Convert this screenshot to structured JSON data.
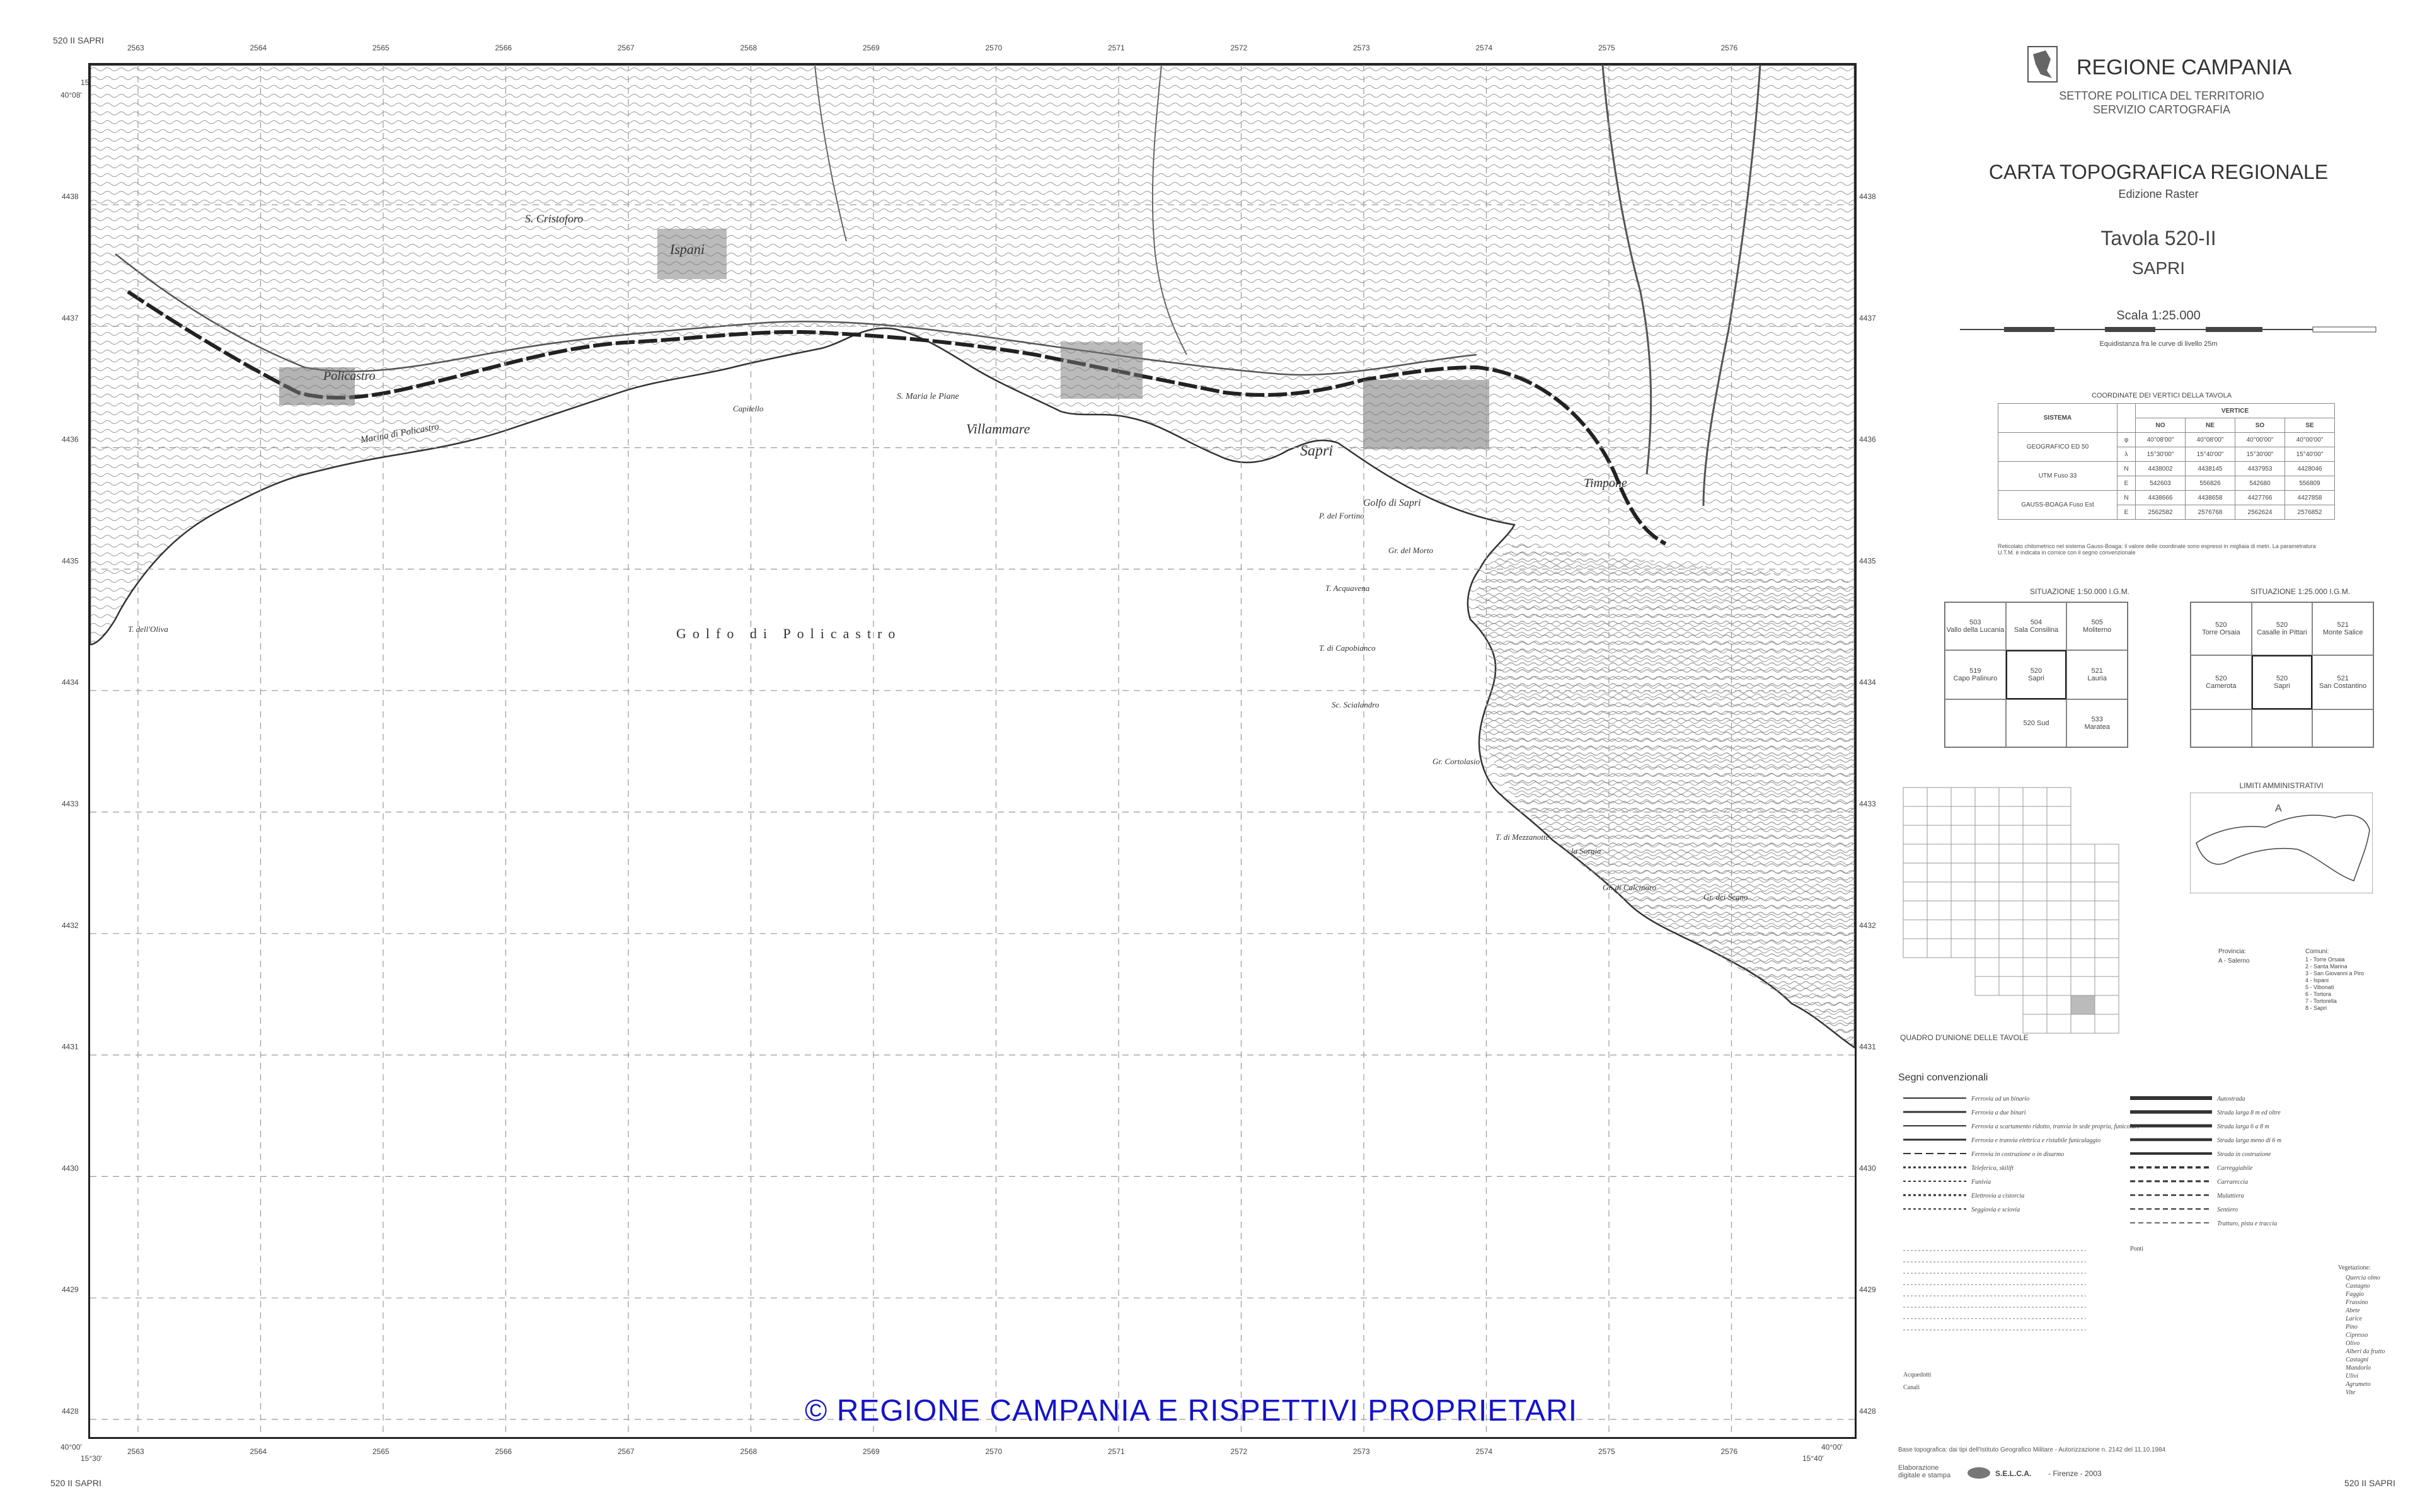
{
  "sheet_corner_top": "520 II SAPRI",
  "sheet_corner_bottom_left": "520 II SAPRI",
  "sheet_corner_bottom_right": "520 II SAPRI",
  "map": {
    "corner_lon_left": "15°30'",
    "corner_lon_right": "15°40'",
    "corner_lat": "40°08'",
    "corner_lat_bottom": "40°00'",
    "eastings": [
      "2563",
      "2564",
      "2565",
      "2566",
      "2567",
      "2568",
      "2569",
      "2570",
      "2571",
      "2572",
      "2573",
      "2574",
      "2575",
      "2576"
    ],
    "northings": [
      "4438",
      "4437",
      "4436",
      "4435",
      "4434",
      "4433",
      "4432",
      "4431",
      "4430",
      "4429",
      "4428"
    ],
    "gulf_label": "Golfo di Policastro",
    "places": [
      {
        "name": "Policastro"
      },
      {
        "name": "S. Cristoforo"
      },
      {
        "name": "Ispani"
      },
      {
        "name": "Villammare"
      },
      {
        "name": "Sapri"
      },
      {
        "name": "Golfo di Sapri"
      },
      {
        "name": "Timpone"
      },
      {
        "name": "Capitello"
      },
      {
        "name": "S. Maria le Piane"
      },
      {
        "name": "Marina di Policastro"
      },
      {
        "name": "T. dell'Oliva"
      },
      {
        "name": "P. del Fortino"
      },
      {
        "name": "Gr. del Morto"
      },
      {
        "name": "T. Acquavena"
      },
      {
        "name": "T. di Capobianco"
      },
      {
        "name": "Sc. Scialandro"
      },
      {
        "name": "Gr. Cortolasio"
      },
      {
        "name": "T. di Mezzanotte"
      },
      {
        "name": "la Sorgia"
      },
      {
        "name": "Gr. di Calcinaro"
      },
      {
        "name": "Gr. dei Segno"
      }
    ]
  },
  "copyright": "© REGIONE CAMPANIA E RISPETTIVI PROPRIETARI",
  "header": {
    "region": "REGIONE CAMPANIA",
    "sector": "SETTORE POLITICA DEL TERRITORIO",
    "service": "SERVIZIO CARTOGRAFIA",
    "title": "CARTA TOPOGRAFICA REGIONALE",
    "edition": "Edizione Raster",
    "tavola": "Tavola 520-II",
    "sheet_name": "SAPRI",
    "scale": "Scala 1:25.000",
    "equidistance": "Equidistanza fra le curve di livello 25m"
  },
  "coord_table": {
    "title": "COORDINATE DEI VERTICI DELLA TAVOLA",
    "header_system": "SISTEMA",
    "header_vertici": "VERTICE",
    "corners": [
      "NO",
      "NE",
      "SO",
      "SE"
    ],
    "rows": [
      {
        "system": "GEOGRAFICO ED 50",
        "sym": "φ",
        "values": [
          "40°08'00\"",
          "40°08'00\"",
          "40°00'00\"",
          "40°00'00\""
        ]
      },
      {
        "system": "",
        "sym": "λ",
        "values": [
          "15°30'00\"",
          "15°40'00\"",
          "15°30'00\"",
          "15°40'00\""
        ]
      },
      {
        "system": "UTM Fuso 33",
        "sym": "N",
        "values": [
          "4438002",
          "4438145",
          "4437953",
          "4428046"
        ]
      },
      {
        "system": "",
        "sym": "E",
        "values": [
          "542603",
          "556826",
          "542680",
          "556809"
        ]
      },
      {
        "system": "GAUSS-BOAGA Fuso Est",
        "sym": "N",
        "values": [
          "4438666",
          "4438658",
          "4427766",
          "4427858"
        ]
      },
      {
        "system": "",
        "sym": "E",
        "values": [
          "2562582",
          "2576768",
          "2562624",
          "2576852"
        ]
      }
    ],
    "note": "Reticolato chilometrico nel sistema Gauss-Boaga: il valore delle coordinate sono espressi in migliaia di metri. La parametratura U.T.M. è indicata in cornice con il segno convenzionale"
  },
  "situation_50k": {
    "title": "SITUAZIONE 1:50.000 I.G.M.",
    "cells": [
      {
        "num": "503",
        "name": "Vallo della Lucania"
      },
      {
        "num": "504",
        "name": "Sala Consilina"
      },
      {
        "num": "505",
        "name": "Moliterno"
      },
      {
        "num": "519",
        "name": "Capo Palinuro"
      },
      {
        "num": "520",
        "name": "Sapri"
      },
      {
        "num": "521",
        "name": "Lauria"
      },
      {
        "num": "",
        "name": ""
      },
      {
        "num": "520 Sud",
        "name": ""
      },
      {
        "num": "533",
        "name": "Maratea"
      }
    ]
  },
  "situation_25k": {
    "title": "SITUAZIONE 1:25.000 I.G.M.",
    "cells": [
      {
        "num": "520",
        "name": "Torre Orsaia"
      },
      {
        "num": "520",
        "name": "Casalle in Pittari"
      },
      {
        "num": "521",
        "name": "Monte Salice"
      },
      {
        "num": "520",
        "name": "Camerota"
      },
      {
        "num": "520",
        "name": "Sapri"
      },
      {
        "num": "521",
        "name": "San Costantino"
      },
      {
        "num": "",
        "name": ""
      },
      {
        "num": "",
        "name": ""
      },
      {
        "num": "",
        "name": ""
      }
    ]
  },
  "limits": {
    "title": "LIMITI AMMINISTRATIVI",
    "provincia_label": "Provincia:",
    "provincia": "A - Salerno",
    "comuni_label": "Comuni:",
    "comuni": [
      "1 - Torre Orsaia",
      "2 - Santa Marina",
      "3 - San Giovanni a Piro",
      "4 - Ispani",
      "5 - Vibonati",
      "6 - Tortora",
      "7 - Tortorella",
      "8 - Sapri"
    ]
  },
  "union_label": "QUADRO D'UNIONE DELLE TAVOLE",
  "legend": {
    "title": "Segni convenzionali",
    "items_left": [
      "Ferrovia ad un binario",
      "Ferrovia a due binari",
      "Ferrovia a scartamento ridotto, tranvia in sede propria, funicolare",
      "Ferrovia e tranvia elettrica e ristabile funiculaggio",
      "Ferrovia in costruzione o in disarmo",
      "Teleferica, skilift",
      "Funivia",
      "Elettrovia a cistorcia",
      "Seggiovia e sciovia"
    ],
    "items_right": [
      "Autostrada",
      "Strada larga 8 m ed oltre",
      "Strada larga 6 a 8 m",
      "Strada larga meno di 6 m",
      "Strada in costruzione",
      "Carreggiabile",
      "Carrareccia",
      "Mulattiera",
      "Sentiero",
      "Tratturo, pista e traccia"
    ],
    "ponti_label": "Ponti",
    "acquedotti_label": "Acquedotti",
    "canali_label": "Canali",
    "vegetazione_label": "Vegetazione:",
    "vegetazione": [
      "Quercia olmo",
      "Castagno",
      "Faggio",
      "Frassino",
      "Abete",
      "Larice",
      "Pino",
      "Cipresso",
      "Olivo",
      "Alberi da frutto",
      "Castagni",
      "Mandorlo",
      "Ulivi",
      "Agrumeto",
      "Vite"
    ]
  },
  "footer": {
    "base": "Base topografica: dai tipi dell'Istituto Geografico Militare - Autorizzazione n. 2142 del 11.10.1984",
    "elaboration": "Elaborazione digitale e stampa",
    "company": "S.E.L.C.A.",
    "place_year": "- Firenze - 2003"
  }
}
